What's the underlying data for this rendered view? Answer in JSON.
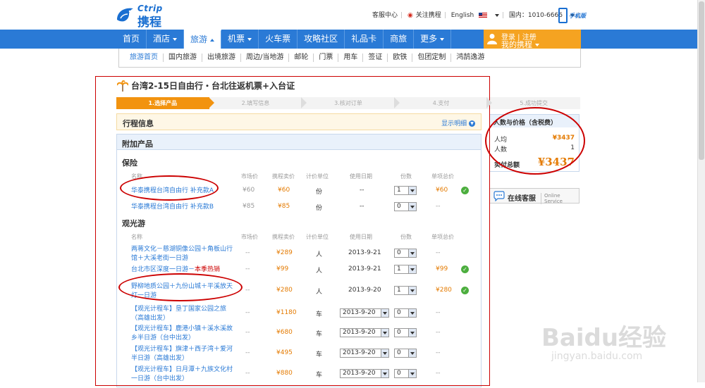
{
  "header": {
    "logo_brand": "Ctrip",
    "logo_cn": "携程",
    "links": [
      "客服中心",
      "关注携程",
      "English"
    ],
    "phone": "国内：1010-6666",
    "mobile": "手机版",
    "icons": [
      "weibo-icon",
      "us-flag-icon",
      "phone-icon"
    ]
  },
  "nav": {
    "items": [
      {
        "label": "首页",
        "has_caret": false
      },
      {
        "label": "酒店",
        "has_caret": true
      },
      {
        "label": "旅游",
        "has_caret": true,
        "active": true
      },
      {
        "label": "机票",
        "has_caret": true
      },
      {
        "label": "火车票",
        "has_caret": false
      },
      {
        "label": "攻略社区",
        "has_caret": false
      },
      {
        "label": "礼品卡",
        "has_caret": false
      },
      {
        "label": "商旅",
        "has_caret": false
      },
      {
        "label": "更多",
        "has_caret": true
      }
    ],
    "login_line1": "登录 | 注册",
    "login_line2": "我的携程"
  },
  "subnav": [
    "旅游首页",
    "国内旅游",
    "出境旅游",
    "周边/当地游",
    "邮轮",
    "门票",
    "用车",
    "签证",
    "欧铁",
    "包团定制",
    "鸿鹄逸游"
  ],
  "page_title": "台湾2-15日自由行・台北往返机票+入台证",
  "steps": [
    "1.选择产品",
    "2.填写信息",
    "3.核对订单",
    "4.支付",
    "5.成功提交"
  ],
  "trip_info": {
    "title": "行程信息",
    "link": "显示明细"
  },
  "addon": {
    "title": "附加产品",
    "insurance": {
      "title": "保险",
      "headers": [
        "名称",
        "市场价",
        "携程卖价",
        "计价单位",
        "使用日期",
        "份数",
        "单项总价"
      ],
      "rows": [
        {
          "name": "华泰携程台湾自由行 补充款A",
          "market": "¥60",
          "ctrip": "¥60",
          "unit": "份",
          "date": "--",
          "qty": "1",
          "total": "¥60",
          "checked": true
        },
        {
          "name": "华泰携程台湾自由行 补充款B",
          "market": "¥85",
          "ctrip": "¥85",
          "unit": "份",
          "date": "--",
          "qty": "0",
          "total": "--",
          "checked": false
        }
      ]
    },
    "tours": {
      "title": "观光游",
      "headers": [
        "名称",
        "市场价",
        "携程卖价",
        "计价单位",
        "使用日期",
        "份数",
        "单项总价"
      ],
      "rows": [
        {
          "name1": "两蒋文化－慈湖铜像公园＋角板山行",
          "name2": "馆＋大溪老街一日游",
          "hot": "",
          "market": "--",
          "ctrip": "¥289",
          "unit": "人",
          "date": "2013-9-21",
          "date_select": false,
          "qty": "0",
          "total": "--",
          "checked": false
        },
        {
          "name1": "台北市区深度一日游－",
          "name2": "",
          "hot": "本季热销",
          "market": "--",
          "ctrip": "¥99",
          "unit": "人",
          "date": "2013-9-21",
          "date_select": false,
          "qty": "1",
          "total": "¥99",
          "checked": true
        },
        {
          "name1": "野柳地质公园＋九份山城＋平溪放天",
          "name2": "灯一日游",
          "hot": "",
          "market": "--",
          "ctrip": "¥280",
          "unit": "人",
          "date": "2013-9-20",
          "date_select": false,
          "qty": "1",
          "total": "¥280",
          "checked": true
        },
        {
          "name1": "【观光计程车】垦丁国家公园之旅",
          "name2": "（高雄出发）",
          "hot": "",
          "market": "--",
          "ctrip": "¥1180",
          "unit": "车",
          "date": "2013-9-20",
          "date_select": true,
          "qty": "0",
          "total": "--",
          "checked": false
        },
        {
          "name1": "【观光计程车】鹿港小镇＋溪水溪故",
          "name2": "乡半日游（台中出发）",
          "hot": "",
          "market": "--",
          "ctrip": "¥680",
          "unit": "车",
          "date": "2013-9-20",
          "date_select": true,
          "qty": "0",
          "total": "--",
          "checked": false
        },
        {
          "name1": "【观光计程车】旗津＋西子湾＋爱河",
          "name2": "半日游（高雄出发）",
          "hot": "",
          "market": "--",
          "ctrip": "¥495",
          "unit": "车",
          "date": "2013-9-20",
          "date_select": true,
          "qty": "0",
          "total": "--",
          "checked": false
        },
        {
          "name1": "【观光计程车】日月潭＋九族文化村",
          "name2": "一日游（台中出发）",
          "hot": "",
          "market": "--",
          "ctrip": "¥880",
          "unit": "车",
          "date": "2013-9-20",
          "date_select": true,
          "qty": "0",
          "total": "--",
          "checked": false
        }
      ]
    }
  },
  "price_box": {
    "title": "人数与价格（含税费）",
    "per_person_label": "人均",
    "per_person": "¥3437",
    "count_label": "人数",
    "count": "1",
    "total_label": "实付总额",
    "total": "¥3437"
  },
  "service": {
    "label": "在线客服",
    "en": "Online Service"
  },
  "watermark": {
    "text": "Baidu经验",
    "url": "jingyan.baidu.com"
  },
  "colors": {
    "nav": "#2a7ad6",
    "accent": "#f5a321",
    "price": "#e47a00",
    "annotation": "#cc0000"
  }
}
